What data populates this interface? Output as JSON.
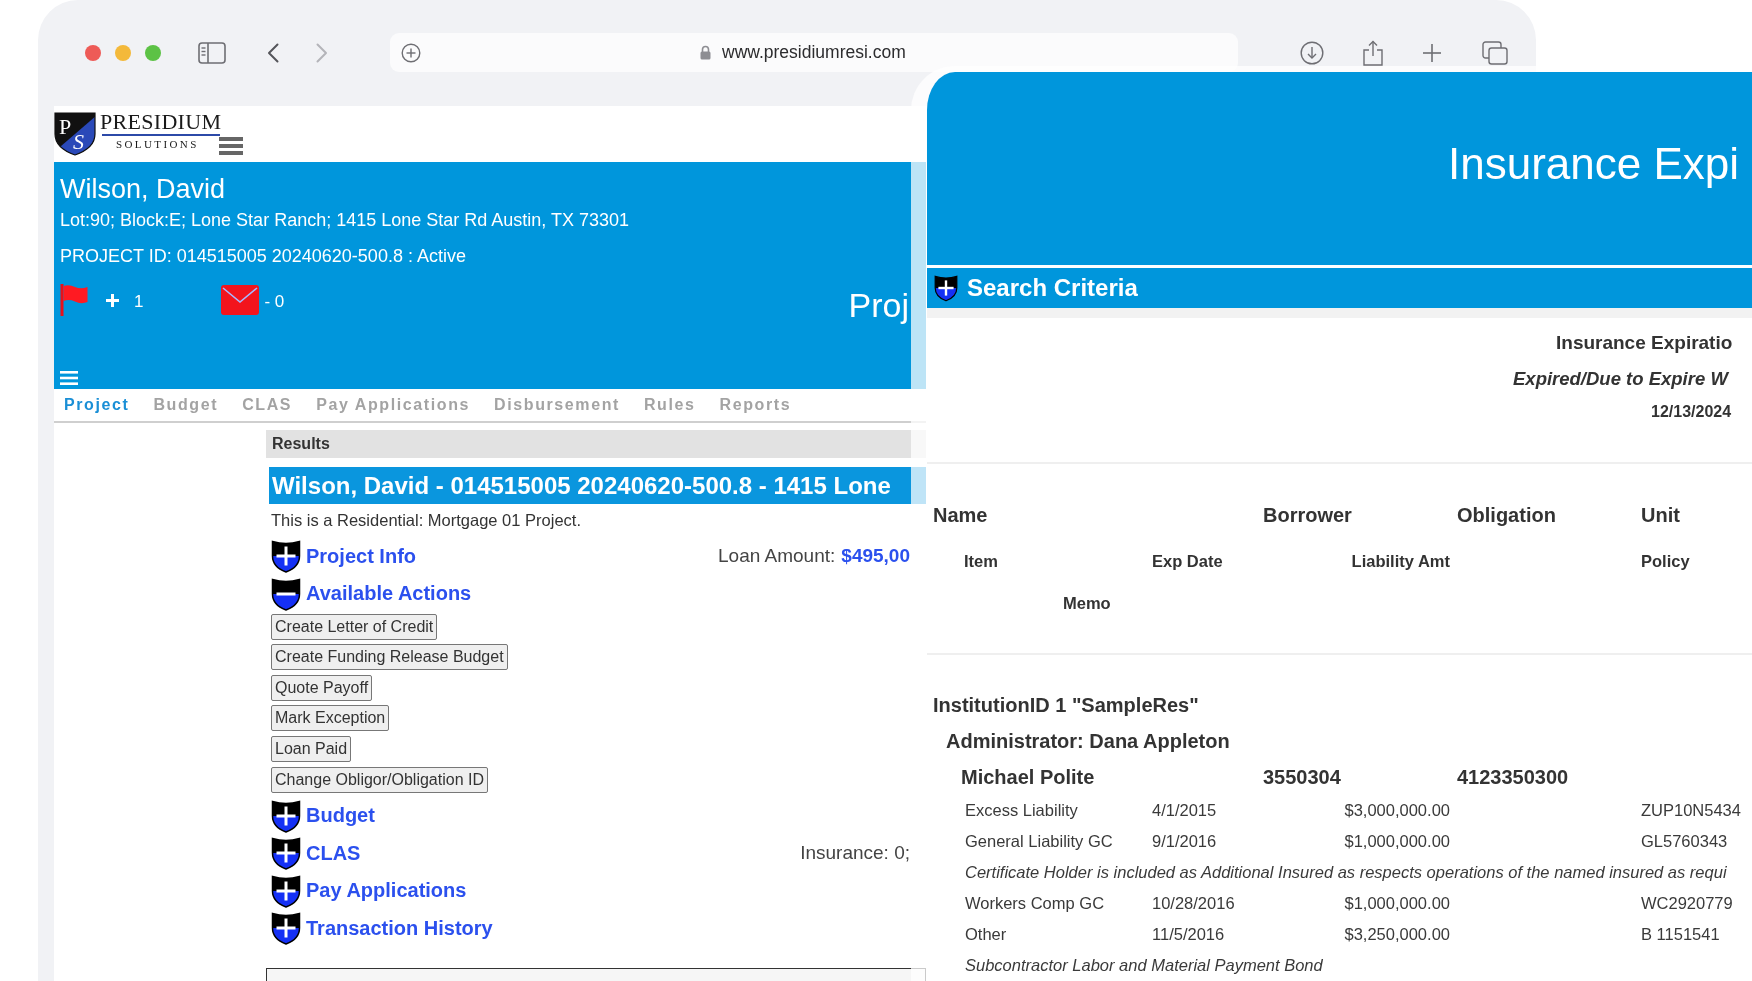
{
  "browser": {
    "url": "www.presidiumresi.com",
    "back_enabled": true,
    "forward_enabled": false
  },
  "logo": {
    "monogram": [
      "P",
      "S"
    ],
    "name": "PRESIDIUM",
    "tagline": "SOLUTIONS"
  },
  "project_header": {
    "name": "Wilson, David",
    "address": "Lot:90; Block:E; Lone Star Ranch; 1415 Lone Star Rd Austin, TX 73301",
    "project_id": "PROJECT ID: 014515005 20240620-500.8 : Active",
    "flag_count": "1",
    "message_count": "- 0",
    "page_title": "Proj"
  },
  "tabs": [
    {
      "label": "Project",
      "selected": true
    },
    {
      "label": "Budget",
      "selected": false
    },
    {
      "label": "CLAS",
      "selected": false
    },
    {
      "label": "Pay Applications",
      "selected": false
    },
    {
      "label": "Disbursement",
      "selected": false
    },
    {
      "label": "Rules",
      "selected": false
    },
    {
      "label": "Reports",
      "selected": false
    }
  ],
  "results": {
    "heading": "Results",
    "title": "Wilson, David - 014515005 20240620-500.8 - 1415 Lone",
    "description": "This is a Residential: Mortgage 01 Project.",
    "sections": [
      {
        "label": "Project Info",
        "expanded": false,
        "info": {
          "label": "Loan Amount:",
          "value": "$495,00"
        }
      },
      {
        "label": "Available Actions",
        "expanded": true,
        "actions": [
          "Create Letter of Credit",
          "Create Funding Release Budget",
          "Quote Payoff",
          "Mark Exception",
          "Loan Paid",
          "Change Obligor/Obligation ID"
        ]
      },
      {
        "label": "Budget",
        "expanded": false
      },
      {
        "label": "CLAS",
        "expanded": false,
        "info": {
          "label": "Insurance: 0;"
        }
      },
      {
        "label": "Pay Applications",
        "expanded": false
      },
      {
        "label": "Transaction History",
        "expanded": false
      }
    ]
  },
  "report": {
    "title": "Insurance Expi",
    "search_criteria": {
      "label": "Search Criteria",
      "expanded": false
    },
    "heading": "Insurance Expiratio",
    "subheading": "Expired/Due to Expire W",
    "date": "12/13/2024",
    "columns": [
      "Name",
      "Borrower",
      "Obligation",
      "Unit"
    ],
    "sub_columns": [
      "Item",
      "Exp Date",
      "Liability Amt",
      "Policy"
    ],
    "memo_column": "Memo",
    "institution": {
      "label": "InstitutionID 1 \"SampleRes\"",
      "administrator": {
        "label": "Administrator: Dana Appleton",
        "borrowers": [
          {
            "name": "Michael Polite",
            "borrower": "3550304",
            "obligation": "4123350300",
            "entries": [
              {
                "kind": "policy",
                "item": "Excess Liability",
                "exp_date": "4/1/2015",
                "liability_amt": "$3,000,000.00",
                "policy": "ZUP10N5434"
              },
              {
                "kind": "policy",
                "item": "General Liability GC",
                "exp_date": "9/1/2016",
                "liability_amt": "$1,000,000.00",
                "policy": "GL5760343"
              },
              {
                "kind": "memo",
                "memo": "Certificate Holder is included as Additional Insured as respects operations of the named insured as requi"
              },
              {
                "kind": "policy",
                "item": "Workers Comp GC",
                "exp_date": "10/28/2016",
                "liability_amt": "$1,000,000.00",
                "policy": "WC2920779"
              },
              {
                "kind": "policy",
                "item": "Other",
                "exp_date": "11/5/2016",
                "liability_amt": "$3,250,000.00",
                "policy": "B 1151541"
              },
              {
                "kind": "memo",
                "memo": "Subcontractor Labor and Material Payment Bond"
              }
            ]
          }
        ]
      }
    }
  }
}
